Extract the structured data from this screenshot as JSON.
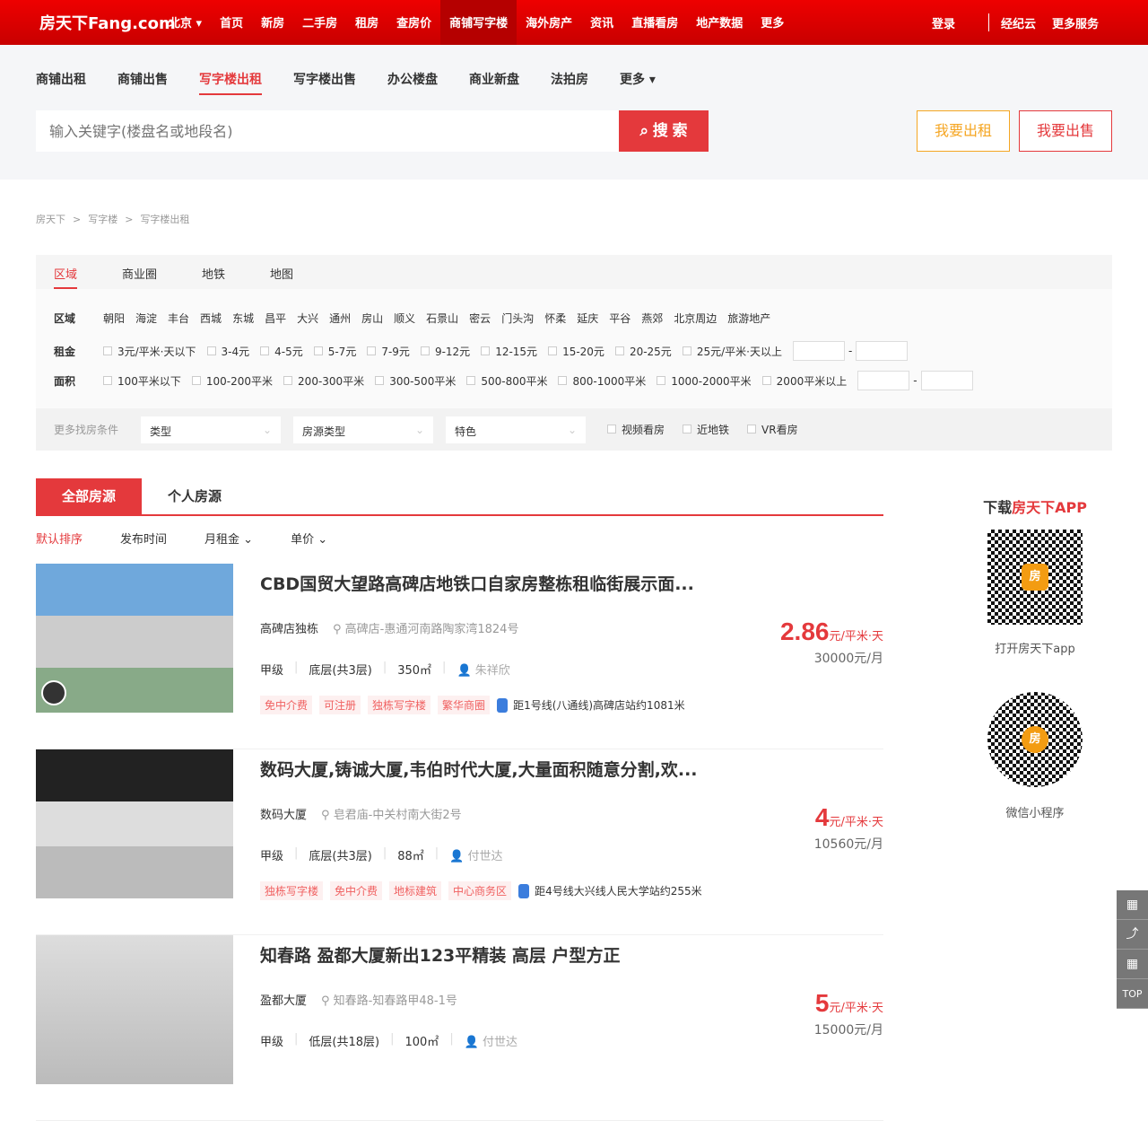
{
  "header": {
    "logo": "房天下Fang.com",
    "city": "北京 ▾",
    "nav": [
      "首页",
      "新房",
      "二手房",
      "租房",
      "查房价",
      "商铺写字楼",
      "海外房产",
      "资讯",
      "直播看房",
      "地产数据",
      "更多"
    ],
    "right": [
      "登录",
      "经纪云",
      "更多服务"
    ]
  },
  "subnav": {
    "tabs": [
      "商铺出租",
      "商铺出售",
      "写字楼出租",
      "写字楼出售",
      "办公楼盘",
      "商业新盘",
      "法拍房",
      "更多 ▾"
    ],
    "search_placeholder": "输入关键字(楼盘名或地段名)",
    "search_btn": "搜 索",
    "rent_btn": "我要出租",
    "sell_btn": "我要出售"
  },
  "breadcrumb": [
    "房天下",
    "写字楼",
    "写字楼出租"
  ],
  "filter": {
    "tabs": [
      "区域",
      "商业圈",
      "地铁",
      "地图"
    ],
    "area_label": "区域",
    "areas": [
      "朝阳",
      "海淀",
      "丰台",
      "西城",
      "东城",
      "昌平",
      "大兴",
      "通州",
      "房山",
      "顺义",
      "石景山",
      "密云",
      "门头沟",
      "怀柔",
      "延庆",
      "平谷",
      "燕郊",
      "北京周边",
      "旅游地产"
    ],
    "rent_label": "租金",
    "rents": [
      "3元/平米·天以下",
      "3-4元",
      "4-5元",
      "5-7元",
      "7-9元",
      "9-12元",
      "12-15元",
      "15-20元",
      "20-25元",
      "25元/平米·天以上"
    ],
    "size_label": "面积",
    "sizes": [
      "100平米以下",
      "100-200平米",
      "200-300平米",
      "300-500平米",
      "500-800平米",
      "800-1000平米",
      "1000-2000平米",
      "2000平米以上"
    ],
    "dash": "-",
    "more_label": "更多找房条件",
    "selects": [
      "类型",
      "房源类型",
      "特色"
    ],
    "checks": [
      "视频看房",
      "近地铁",
      "VR看房"
    ]
  },
  "list": {
    "tabs": [
      "全部房源",
      "个人房源"
    ],
    "sort": [
      "默认排序",
      "发布时间",
      "月租金 ⌄",
      "单价 ⌄"
    ],
    "items": [
      {
        "title": "CBD国贸大望路高碑店地铁口自家房整栋租临街展示面...",
        "name": "高碑店独栋",
        "addr": "高碑店-惠通河南路陶家湾1824号",
        "grade": "甲级",
        "floor": "底层(共3层)",
        "area": "350㎡",
        "agent": "朱祥欣",
        "tags": [
          "免中介费",
          "可注册",
          "独栋写字楼",
          "繁华商圈"
        ],
        "subway": "距1号线(八通线)高碑店站约1081米",
        "price": "2.86",
        "unit": "元/平米·天",
        "monthly": "30000元/月"
      },
      {
        "title": "数码大厦,铸诚大厦,韦伯时代大厦,大量面积随意分割,欢...",
        "name": "数码大厦",
        "addr": "皂君庙-中关村南大街2号",
        "grade": "甲级",
        "floor": "底层(共3层)",
        "area": "88㎡",
        "agent": "付世达",
        "tags": [
          "独栋写字楼",
          "免中介费",
          "地标建筑",
          "中心商务区"
        ],
        "subway": "距4号线大兴线人民大学站约255米",
        "price": "4",
        "unit": "元/平米·天",
        "monthly": "10560元/月"
      },
      {
        "title": "知春路 盈都大厦新出123平精装 高层 户型方正",
        "name": "盈都大厦",
        "addr": "知春路-知春路甲48-1号",
        "grade": "甲级",
        "floor": "低层(共18层)",
        "area": "100㎡",
        "agent": "付世达",
        "tags": [],
        "subway": "",
        "price": "5",
        "unit": "元/平米·天",
        "monthly": "15000元/月"
      }
    ]
  },
  "side": {
    "app_pre": "下载",
    "app_name": "房天下APP",
    "qr_char": "房",
    "open_app": "打开房天下app",
    "mini": "微信小程序"
  },
  "float": [
    "▦",
    "⤴",
    "▦",
    "TOP"
  ],
  "colors": {
    "brand": "#e4393c",
    "orange": "#f39c12"
  }
}
